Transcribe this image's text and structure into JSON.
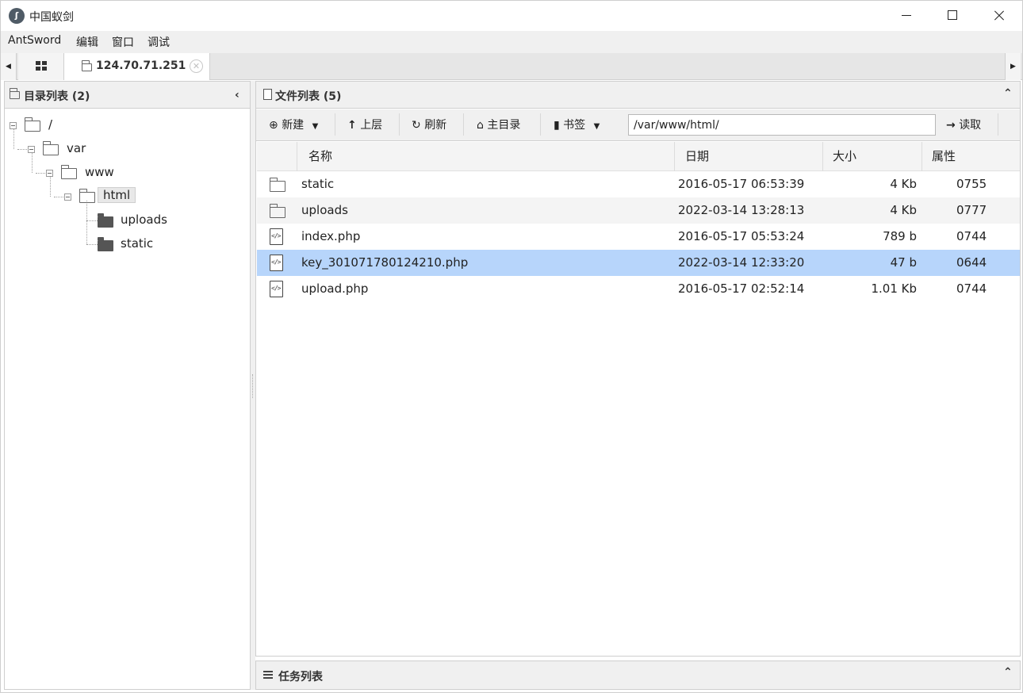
{
  "window": {
    "title": "中国蚁剑",
    "app_icon_glyph": "ʃ",
    "controls": [
      "minimize",
      "maximize",
      "close"
    ]
  },
  "menubar": {
    "items": [
      "AntSword",
      "编辑",
      "窗口",
      "调试"
    ]
  },
  "tabs": {
    "left_arrow": "◀",
    "right_arrow": "▶",
    "active_tab": {
      "label": "124.70.71.251",
      "close_glyph": "✕"
    }
  },
  "dir_panel": {
    "title": "目录列表 (2)",
    "collapse_glyph": "‹",
    "tree": [
      {
        "label": "/"
      },
      {
        "label": "var"
      },
      {
        "label": "www"
      },
      {
        "label": "html",
        "selected": true
      },
      {
        "label": "uploads"
      },
      {
        "label": "static"
      }
    ]
  },
  "file_panel": {
    "title": "文件列表 (5)",
    "collapse_glyph": "⌃",
    "toolbar": {
      "new_label": "新建",
      "up_label": "上层",
      "refresh_label": "刷新",
      "home_label": "主目录",
      "bookmark_label": "书签",
      "path_value": "/var/www/html/",
      "read_label": "读取"
    },
    "columns": {
      "name": "名称",
      "date": "日期",
      "size": "大小",
      "perm": "属性"
    },
    "files": [
      {
        "name": "static",
        "date": "2016-05-17 06:53:39",
        "size": "4 Kb",
        "perm": "0755",
        "type": "folder"
      },
      {
        "name": "uploads",
        "date": "2022-03-14 13:28:13",
        "size": "4 Kb",
        "perm": "0777",
        "type": "folder"
      },
      {
        "name": "index.php",
        "date": "2016-05-17 05:53:24",
        "size": "789 b",
        "perm": "0744",
        "type": "code"
      },
      {
        "name": "key_301071780124210.php",
        "date": "2022-03-14 12:33:20",
        "size": "47 b",
        "perm": "0644",
        "type": "code",
        "selected": true
      },
      {
        "name": "upload.php",
        "date": "2016-05-17 02:52:14",
        "size": "1.01 Kb",
        "perm": "0744",
        "type": "code"
      }
    ]
  },
  "task_panel": {
    "title": "任务列表",
    "collapse_glyph": "⌃"
  },
  "colors": {
    "selected_row": "#b7d5fb",
    "panel_header": "#f0f0f0",
    "border": "#cfcfcf"
  }
}
